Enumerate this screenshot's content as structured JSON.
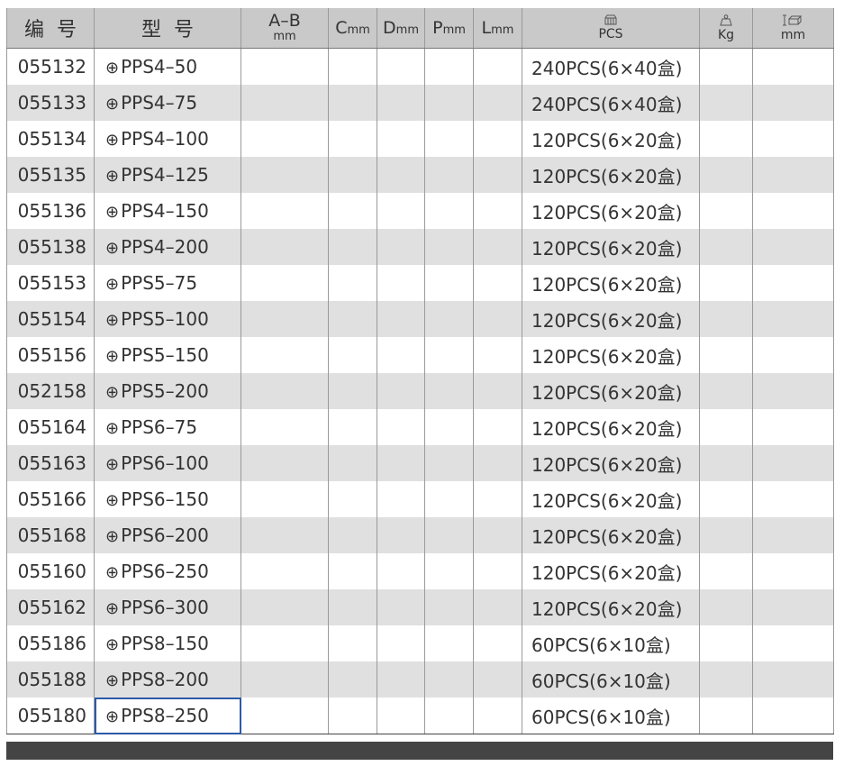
{
  "header": {
    "code": "编号",
    "model": "型号",
    "ab_top": "A–B",
    "ab_unit": "mm",
    "c_letter": "C",
    "d_letter": "D",
    "p_letter": "P",
    "l_letter": "L",
    "mm_unit": "mm",
    "pcs_icon": "box-icon",
    "pcs_label": "PCS",
    "kg_icon": "weight-icon",
    "kg_label": "Kg",
    "size_icon": "carton-size-icon",
    "size_label": "mm"
  },
  "phillips_symbol": "⊕",
  "rows": [
    {
      "code": "055132",
      "model": "PPS4–50",
      "pack": "240PCS(6×40盒)"
    },
    {
      "code": "055133",
      "model": "PPS4–75",
      "pack": "240PCS(6×40盒)"
    },
    {
      "code": "055134",
      "model": "PPS4–100",
      "pack": "120PCS(6×20盒)"
    },
    {
      "code": "055135",
      "model": "PPS4–125",
      "pack": "120PCS(6×20盒)"
    },
    {
      "code": "055136",
      "model": "PPS4–150",
      "pack": "120PCS(6×20盒)"
    },
    {
      "code": "055138",
      "model": "PPS4–200",
      "pack": "120PCS(6×20盒)"
    },
    {
      "code": "055153",
      "model": "PPS5–75",
      "pack": "120PCS(6×20盒)"
    },
    {
      "code": "055154",
      "model": "PPS5–100",
      "pack": "120PCS(6×20盒)"
    },
    {
      "code": "055156",
      "model": "PPS5–150",
      "pack": "120PCS(6×20盒)"
    },
    {
      "code": "052158",
      "model": "PPS5–200",
      "pack": "120PCS(6×20盒)"
    },
    {
      "code": "055164",
      "model": "PPS6–75",
      "pack": "120PCS(6×20盒)"
    },
    {
      "code": "055163",
      "model": "PPS6–100",
      "pack": "120PCS(6×20盒)"
    },
    {
      "code": "055166",
      "model": "PPS6–150",
      "pack": "120PCS(6×20盒)"
    },
    {
      "code": "055168",
      "model": "PPS6–200",
      "pack": "120PCS(6×20盒)"
    },
    {
      "code": "055160",
      "model": "PPS6–250",
      "pack": "120PCS(6×20盒)"
    },
    {
      "code": "055162",
      "model": "PPS6–300",
      "pack": "120PCS(6×20盒)"
    },
    {
      "code": "055186",
      "model": "PPS8–150",
      "pack": "60PCS(6×10盒)"
    },
    {
      "code": "055188",
      "model": "PPS8–200",
      "pack": "60PCS(6×10盒)"
    },
    {
      "code": "055180",
      "model": "PPS8–250",
      "pack": "60PCS(6×10盒)"
    }
  ],
  "colors": {
    "header_bg": "#c9c9c9",
    "stripe_bg": "#e0e0e0",
    "selection": "#2e5aa8",
    "footer_bar": "#444444"
  }
}
